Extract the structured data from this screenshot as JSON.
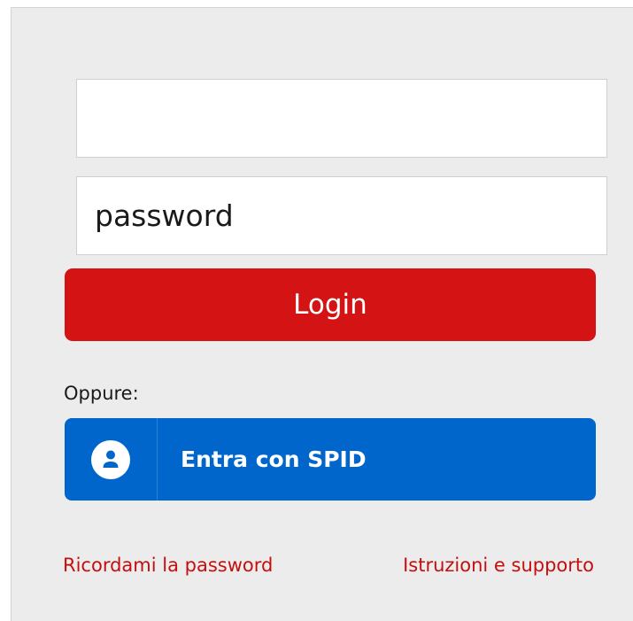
{
  "login_form": {
    "username": {
      "value": "",
      "placeholder": ""
    },
    "password": {
      "value": "",
      "placeholder": "password"
    },
    "login_label": "Login",
    "accent_color": "#d41414"
  },
  "alternative": {
    "label": "Oppure:",
    "spid_label": "Entra con SPID",
    "spid_icon": "user-circle-icon",
    "spid_color": "#0066cc"
  },
  "footer_links": {
    "remind_password": "Ricordami la password",
    "support": "Istruzioni e supporto"
  }
}
